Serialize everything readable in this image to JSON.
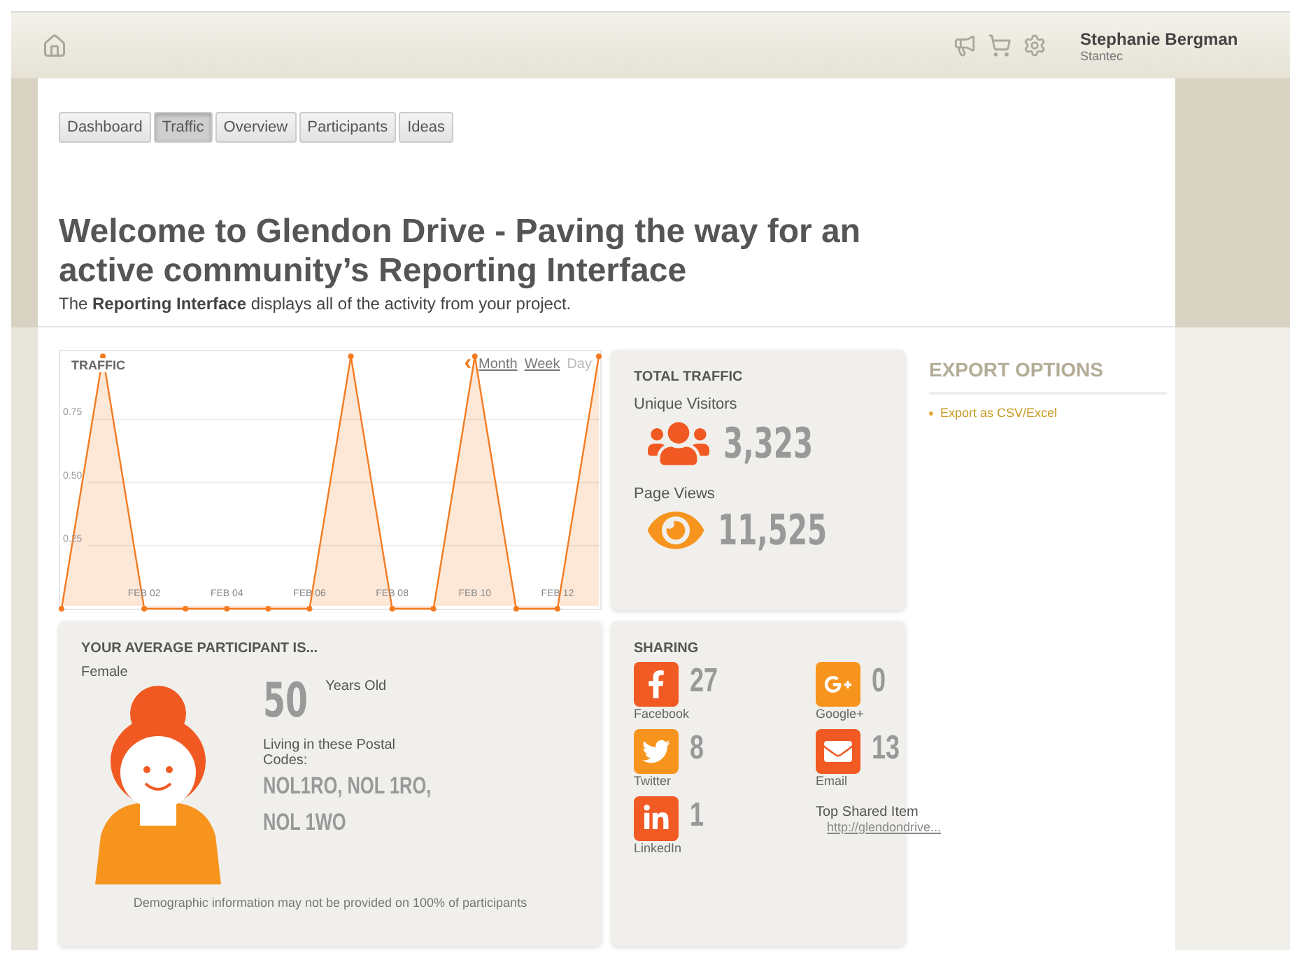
{
  "header": {
    "user_name": "Stephanie Bergman",
    "user_org": "Stantec"
  },
  "tabs": [
    {
      "label": "Dashboard",
      "selected": false
    },
    {
      "label": "Traffic",
      "selected": true
    },
    {
      "label": "Overview",
      "selected": false
    },
    {
      "label": "Participants",
      "selected": false
    },
    {
      "label": "Ideas",
      "selected": false
    }
  ],
  "page": {
    "title": "Welcome to Glendon Drive - Paving the way for an active community’s Reporting Interface",
    "subtitle": "The **Reporting Interface** displays all of the activity from your project."
  },
  "traffic": {
    "title": "TRAFFIC",
    "back": "‹",
    "periods": [
      {
        "label": "Month",
        "selected": false
      },
      {
        "label": "Week",
        "selected": false
      },
      {
        "label": "Day",
        "selected": true
      }
    ],
    "chart_data": {
      "type": "area",
      "categories": [
        null,
        null,
        "FEB 02",
        null,
        "FEB 04",
        null,
        "FEB 06",
        null,
        "FEB 08",
        null,
        "FEB 10",
        null,
        "FEB 12",
        null
      ],
      "series": [
        {
          "color": "#f47b20",
          "values": [
            0,
            1,
            0,
            0,
            0,
            0,
            0,
            1,
            0,
            0,
            1,
            0,
            0,
            1
          ]
        }
      ],
      "ylim": [
        0,
        1.02
      ],
      "grid": true,
      "yticks": [
        {
          "value": 0.25,
          "label": "0.25"
        },
        {
          "value": 0.5,
          "label": "0.50"
        },
        {
          "value": 0.75,
          "label": "0.75"
        }
      ]
    }
  },
  "total_traffic": {
    "title": "TOTAL TRAFFIC",
    "stats": [
      {
        "kind": "visitors",
        "label": "Unique Visitors",
        "value": "3,323"
      },
      {
        "kind": "views",
        "label": "Page Views",
        "value": "11,525"
      }
    ]
  },
  "export": {
    "title": "EXPORT OPTIONS",
    "links": [
      "Export as CSV/Excel"
    ]
  },
  "participant": {
    "title": "YOUR AVERAGE PARTICIPANT IS...",
    "gender": "Female",
    "age": "50",
    "age_label": "Years Old",
    "postal_label": "Living in these Postal Codes:",
    "postal_codes": "NOL1RO, NOL 1RO, NOL 1WO",
    "note": "Demographic information may not be provided on 100% of participants"
  },
  "sharing": {
    "title": "SHARING",
    "items": [
      {
        "kind": "facebook",
        "label": "Facebook",
        "count": "27",
        "color": "#f15a22"
      },
      {
        "kind": "google",
        "label": "Google+",
        "count": "0",
        "color": "#f7941d"
      },
      {
        "kind": "twitter",
        "label": "Twitter",
        "count": "8",
        "color": "#f7941d"
      },
      {
        "kind": "email",
        "label": "Email",
        "count": "13",
        "color": "#f15a22"
      },
      {
        "kind": "linkedin",
        "label": "LinkedIn",
        "count": "1",
        "color": "#f15a22"
      }
    ],
    "top_label": "Top Shared Item",
    "top_link": "http://glendondrive..."
  }
}
